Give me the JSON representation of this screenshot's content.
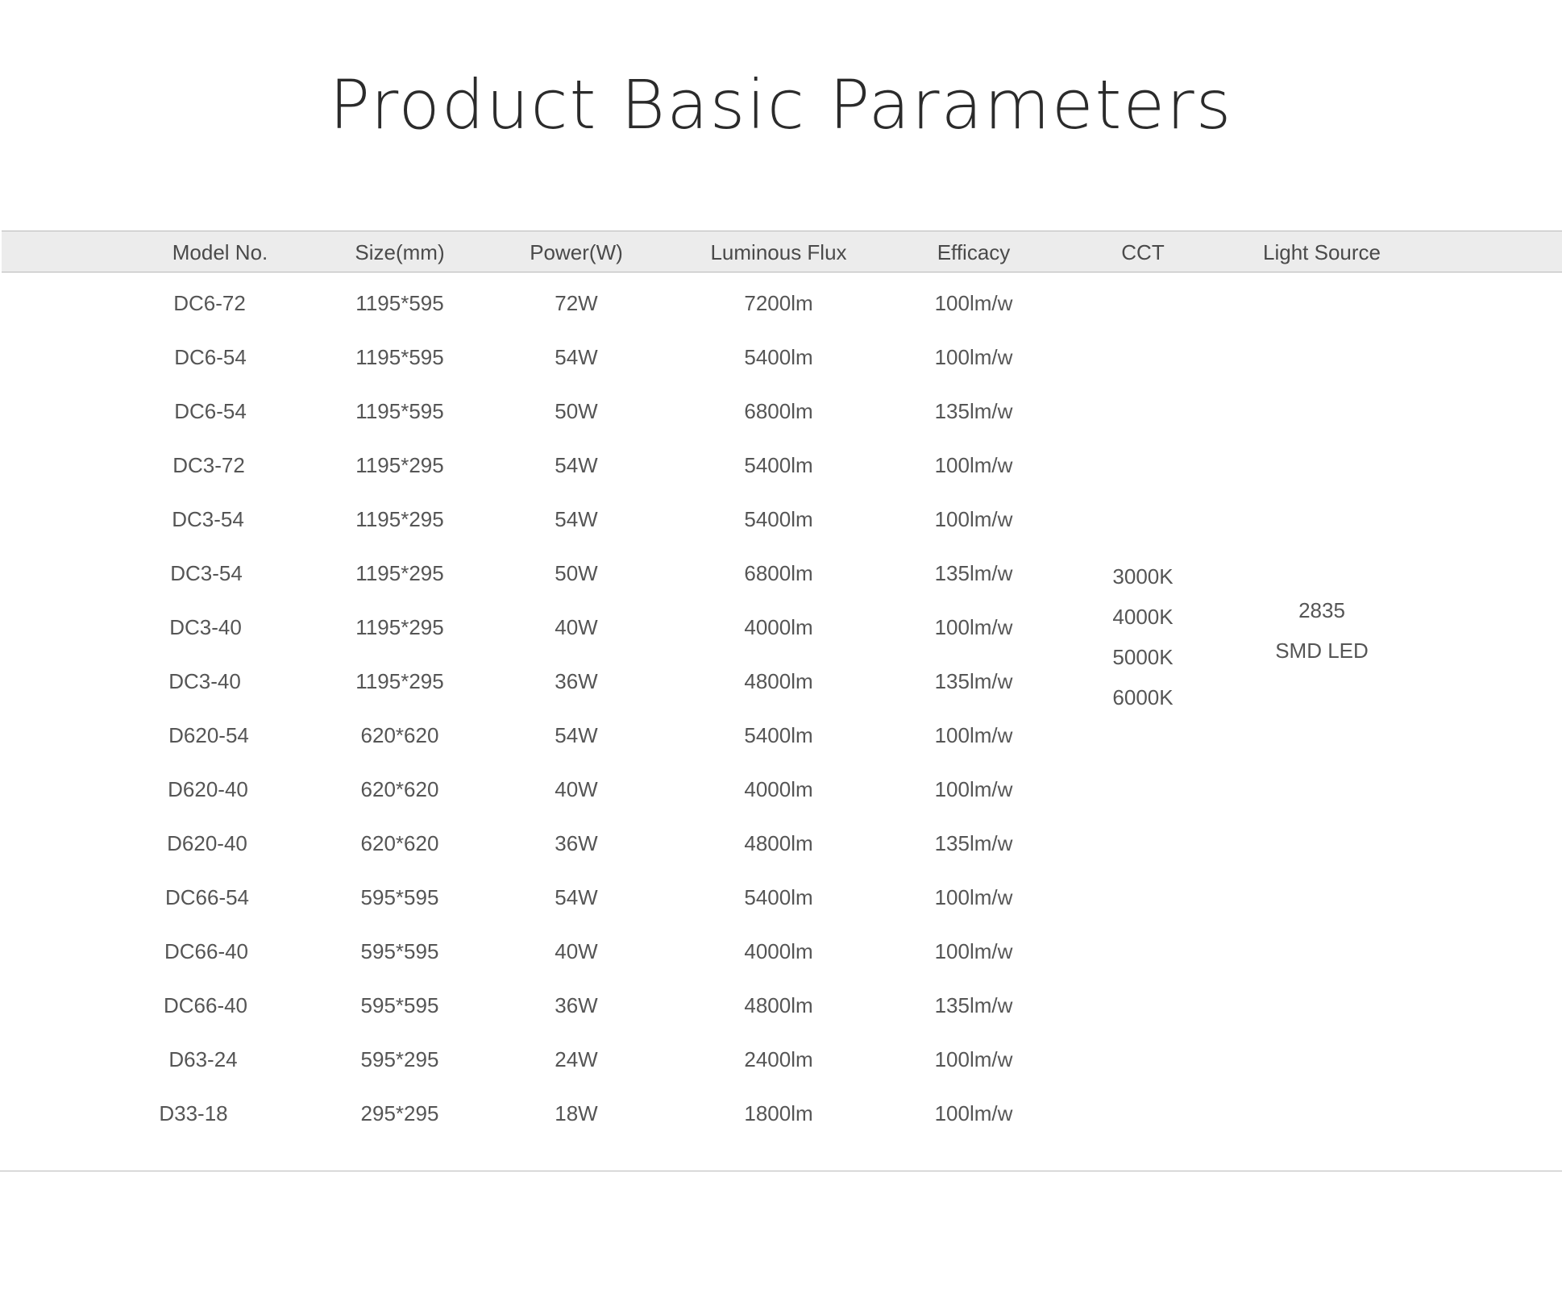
{
  "title": "Product Basic Parameters",
  "table": {
    "headers": [
      "Model No.",
      "Size(mm)",
      "Power(W)",
      "Luminous Flux",
      "Efficacy",
      "CCT",
      "Light Source"
    ],
    "rows": [
      {
        "model": "DC6-72",
        "size": "1195*595",
        "power": "72W",
        "flux": "7200lm",
        "efficacy": "100lm/w"
      },
      {
        "model": "DC6-54",
        "size": "1195*595",
        "power": "54W",
        "flux": "5400lm",
        "efficacy": "100lm/w"
      },
      {
        "model": "DC6-54",
        "size": "1195*595",
        "power": "50W",
        "flux": "6800lm",
        "efficacy": "135lm/w"
      },
      {
        "model": "DC3-72",
        "size": "1195*295",
        "power": "54W",
        "flux": "5400lm",
        "efficacy": "100lm/w"
      },
      {
        "model": "DC3-54",
        "size": "1195*295",
        "power": "54W",
        "flux": "5400lm",
        "efficacy": "100lm/w"
      },
      {
        "model": "DC3-54",
        "size": "1195*295",
        "power": "50W",
        "flux": "6800lm",
        "efficacy": "135lm/w"
      },
      {
        "model": "DC3-40",
        "size": "1195*295",
        "power": "40W",
        "flux": "4000lm",
        "efficacy": "100lm/w"
      },
      {
        "model": "DC3-40",
        "size": "1195*295",
        "power": "36W",
        "flux": "4800lm",
        "efficacy": "135lm/w"
      },
      {
        "model": "D620-54",
        "size": "620*620",
        "power": "54W",
        "flux": "5400lm",
        "efficacy": "100lm/w"
      },
      {
        "model": "D620-40",
        "size": "620*620",
        "power": "40W",
        "flux": "4000lm",
        "efficacy": "100lm/w"
      },
      {
        "model": "D620-40",
        "size": "620*620",
        "power": "36W",
        "flux": "4800lm",
        "efficacy": "135lm/w"
      },
      {
        "model": "DC66-54",
        "size": "595*595",
        "power": "54W",
        "flux": "5400lm",
        "efficacy": "100lm/w"
      },
      {
        "model": "DC66-40",
        "size": "595*595",
        "power": "40W",
        "flux": "4000lm",
        "efficacy": "100lm/w"
      },
      {
        "model": "DC66-40",
        "size": "595*595",
        "power": "36W",
        "flux": "4800lm",
        "efficacy": "135lm/w"
      },
      {
        "model": "D63-24",
        "size": "595*295",
        "power": "24W",
        "flux": "2400lm",
        "efficacy": "100lm/w"
      },
      {
        "model": "D33-18",
        "size": "295*295",
        "power": "18W",
        "flux": "1800lm",
        "efficacy": "100lm/w"
      }
    ],
    "cct": [
      "3000K",
      "4000K",
      "5000K",
      "6000K"
    ],
    "light_source": [
      "2835",
      "SMD LED"
    ]
  }
}
